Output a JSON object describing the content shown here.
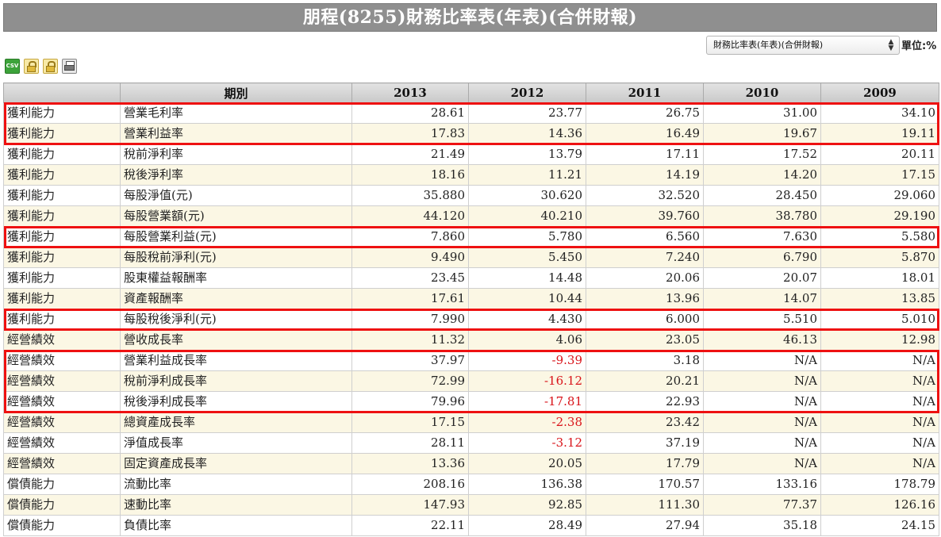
{
  "page": {
    "title": "朋程(8255)財務比率表(年表)(合併財報)"
  },
  "controls": {
    "report_select_value": "財務比率表(年表)(合併財報)",
    "unit_label": "單位:%"
  },
  "toolbar": {
    "csv_label": "CSV"
  },
  "table": {
    "headers": [
      "",
      "期別",
      "2013",
      "2012",
      "2011",
      "2010",
      "2009"
    ],
    "rows": [
      {
        "category": "獲利能力",
        "item": "營業毛利率",
        "values": [
          "28.61",
          "23.77",
          "26.75",
          "31.00",
          "34.10"
        ]
      },
      {
        "category": "獲利能力",
        "item": "營業利益率",
        "values": [
          "17.83",
          "14.36",
          "16.49",
          "19.67",
          "19.11"
        ]
      },
      {
        "category": "獲利能力",
        "item": "稅前淨利率",
        "values": [
          "21.49",
          "13.79",
          "17.11",
          "17.52",
          "20.11"
        ]
      },
      {
        "category": "獲利能力",
        "item": "稅後淨利率",
        "values": [
          "18.16",
          "11.21",
          "14.19",
          "14.20",
          "17.15"
        ]
      },
      {
        "category": "獲利能力",
        "item": "每股淨值(元)",
        "values": [
          "35.880",
          "30.620",
          "32.520",
          "28.450",
          "29.060"
        ]
      },
      {
        "category": "獲利能力",
        "item": "每股營業額(元)",
        "values": [
          "44.120",
          "40.210",
          "39.760",
          "38.780",
          "29.190"
        ]
      },
      {
        "category": "獲利能力",
        "item": "每股營業利益(元)",
        "values": [
          "7.860",
          "5.780",
          "6.560",
          "7.630",
          "5.580"
        ]
      },
      {
        "category": "獲利能力",
        "item": "每股稅前淨利(元)",
        "values": [
          "9.490",
          "5.450",
          "7.240",
          "6.790",
          "5.870"
        ]
      },
      {
        "category": "獲利能力",
        "item": "股東權益報酬率",
        "values": [
          "23.45",
          "14.48",
          "20.06",
          "20.07",
          "18.01"
        ]
      },
      {
        "category": "獲利能力",
        "item": "資產報酬率",
        "values": [
          "17.61",
          "10.44",
          "13.96",
          "14.07",
          "13.85"
        ]
      },
      {
        "category": "獲利能力",
        "item": "每股稅後淨利(元)",
        "values": [
          "7.990",
          "4.430",
          "6.000",
          "5.510",
          "5.010"
        ]
      },
      {
        "category": "經營績效",
        "item": "營收成長率",
        "values": [
          "11.32",
          "4.06",
          "23.05",
          "46.13",
          "12.98"
        ]
      },
      {
        "category": "經營績效",
        "item": "營業利益成長率",
        "values": [
          "37.97",
          "-9.39",
          "3.18",
          "N/A",
          "N/A"
        ]
      },
      {
        "category": "經營績效",
        "item": "稅前淨利成長率",
        "values": [
          "72.99",
          "-16.12",
          "20.21",
          "N/A",
          "N/A"
        ]
      },
      {
        "category": "經營績效",
        "item": "稅後淨利成長率",
        "values": [
          "79.96",
          "-17.81",
          "22.93",
          "N/A",
          "N/A"
        ]
      },
      {
        "category": "經營績效",
        "item": "總資產成長率",
        "values": [
          "17.15",
          "-2.38",
          "23.42",
          "N/A",
          "N/A"
        ]
      },
      {
        "category": "經營績效",
        "item": "淨值成長率",
        "values": [
          "28.11",
          "-3.12",
          "37.19",
          "N/A",
          "N/A"
        ]
      },
      {
        "category": "經營績效",
        "item": "固定資產成長率",
        "values": [
          "13.36",
          "20.05",
          "17.79",
          "N/A",
          "N/A"
        ]
      },
      {
        "category": "償債能力",
        "item": "流動比率",
        "values": [
          "208.16",
          "136.38",
          "170.57",
          "133.16",
          "178.79"
        ]
      },
      {
        "category": "償債能力",
        "item": "速動比率",
        "values": [
          "147.93",
          "92.85",
          "111.30",
          "77.37",
          "126.16"
        ]
      },
      {
        "category": "償債能力",
        "item": "負債比率",
        "values": [
          "22.11",
          "28.49",
          "27.94",
          "35.18",
          "24.15"
        ]
      }
    ],
    "highlighted_rows": [
      [
        0,
        1
      ],
      [
        6,
        6
      ],
      [
        10,
        10
      ],
      [
        12,
        14
      ]
    ],
    "highlight_color": "#ee1111",
    "negative_color": "#d9141a"
  }
}
